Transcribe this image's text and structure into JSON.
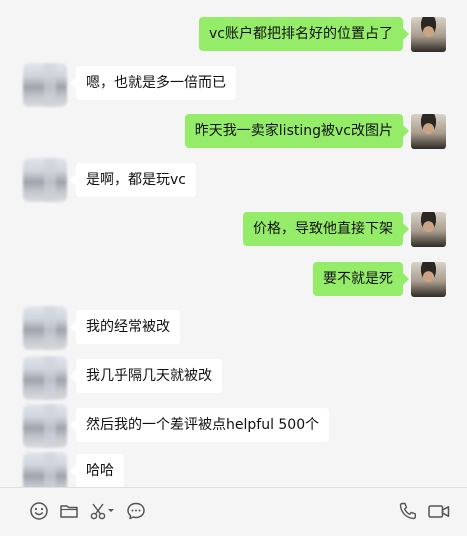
{
  "messages": [
    {
      "side": "self",
      "text": "vc账户都把排名好的位置占了"
    },
    {
      "side": "other",
      "text": "嗯，也就是多一倍而已"
    },
    {
      "side": "self",
      "text": "昨天我一卖家listing被vc改图片"
    },
    {
      "side": "other",
      "text": "是啊，都是玩vc"
    },
    {
      "side": "self",
      "text": "价格，导致他直接下架"
    },
    {
      "side": "self",
      "text": "要不就是死"
    },
    {
      "side": "other",
      "text": "我的经常被改"
    },
    {
      "side": "other",
      "text": "我几乎隔几天就被改"
    },
    {
      "side": "other",
      "text": "然后我的一个差评被点helpful 500个"
    },
    {
      "side": "other",
      "text": "哈哈"
    }
  ],
  "toolbar": {
    "icons": [
      "emoji-icon",
      "folder-icon",
      "scissors-icon",
      "chat-history-icon",
      "phone-icon",
      "video-icon"
    ]
  },
  "colors": {
    "self_bubble": "#95ec69",
    "other_bubble": "#ffffff",
    "background": "#f5f5f5"
  }
}
